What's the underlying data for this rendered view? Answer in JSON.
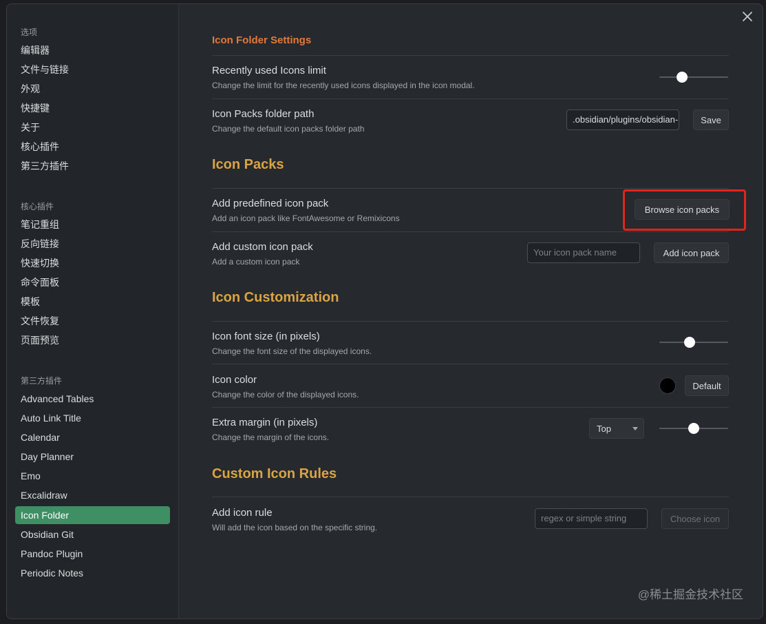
{
  "sidebar": {
    "options_header": "选项",
    "options": [
      "编辑器",
      "文件与链接",
      "外观",
      "快捷键",
      "关于",
      "核心插件",
      "第三方插件"
    ],
    "core_header": "核心插件",
    "core": [
      "笔记重组",
      "反向链接",
      "快速切换",
      "命令面板",
      "模板",
      "文件恢复",
      "页面预览"
    ],
    "third_header": "第三方插件",
    "third": [
      "Advanced Tables",
      "Auto Link Title",
      "Calendar",
      "Day Planner",
      "Emo",
      "Excalidraw",
      "Icon Folder",
      "Obsidian Git",
      "Pandoc Plugin",
      "Periodic Notes"
    ],
    "active": "Icon Folder"
  },
  "colors": {
    "accent_active": "#3e8f64",
    "section_title": "#d9a441",
    "highlight_border": "#e3241b",
    "icon_color": "#000000"
  },
  "icons": {
    "close": "close-icon",
    "caret": "chevron-down-icon"
  },
  "settings": {
    "title": "Icon Folder Settings",
    "recent_limit": {
      "name": "Recently used Icons limit",
      "desc": "Change the limit for the recently used icons displayed in the icon modal.",
      "slider_fraction": 0.33
    },
    "folder_path": {
      "name": "Icon Packs folder path",
      "desc": "Change the default icon packs folder path",
      "value": ".obsidian/plugins/obsidian-icon-folder",
      "save_label": "Save"
    },
    "icon_packs_title": "Icon Packs",
    "predefined": {
      "name": "Add predefined icon pack",
      "desc": "Add an icon pack like FontAwesome or Remixicons",
      "button": "Browse icon packs"
    },
    "custom": {
      "name": "Add custom icon pack",
      "desc": "Add a custom icon pack",
      "placeholder": "Your icon pack name",
      "button": "Add icon pack"
    },
    "customization_title": "Icon Customization",
    "font_size": {
      "name": "Icon font size (in pixels)",
      "desc": "Change the font size of the displayed icons.",
      "slider_fraction": 0.5
    },
    "icon_color": {
      "name": "Icon color",
      "desc": "Change the color of the displayed icons.",
      "button": "Default"
    },
    "margin": {
      "name": "Extra margin (in pixels)",
      "desc": "Change the margin of the icons.",
      "select_value": "Top",
      "slider_fraction": 0.58
    },
    "rules_title": "Custom Icon Rules",
    "rule": {
      "name": "Add icon rule",
      "desc": "Will add the icon based on the specific string.",
      "placeholder": "regex or simple string",
      "button": "Choose icon"
    }
  },
  "watermark": "@稀土掘金技术社区"
}
